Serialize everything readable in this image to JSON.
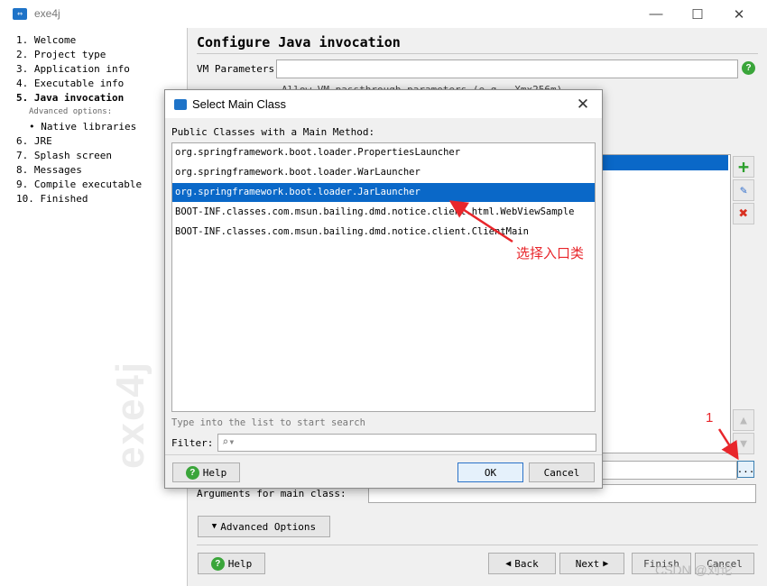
{
  "window": {
    "title": "exe4j",
    "minimize": "—",
    "maximize": "☐",
    "close": "✕"
  },
  "sidebar": {
    "steps": [
      {
        "label": "1.  Welcome"
      },
      {
        "label": "2.  Project type"
      },
      {
        "label": "3.  Application info"
      },
      {
        "label": "4.  Executable info"
      },
      {
        "label": "5.  Java invocation"
      },
      {
        "label": "Advanced options:"
      },
      {
        "label": "• Native libraries"
      },
      {
        "label": "6.  JRE"
      },
      {
        "label": "7.  Splash screen"
      },
      {
        "label": "8.  Messages"
      },
      {
        "label": "9.  Compile executable"
      },
      {
        "label": "10.  Finished"
      }
    ],
    "watermark": "exe4j"
  },
  "page": {
    "title": "Configure Java invocation",
    "vm_parameters_label": "VM Parameters:",
    "vm_parameters_value": "",
    "checkbox_partial": "Allow VM passthrough parameters (e.g. -Xmx256m)",
    "arguments_label": "Arguments for main class:",
    "arguments_value": "",
    "main_class_value": "",
    "advanced_options_label": "Advanced Options",
    "browse_label": "...",
    "help_label": "Help",
    "back_label": "Back",
    "next_label": "Next",
    "finish_label": "Finish",
    "cancel_label": "Cancel"
  },
  "dialog": {
    "title": "Select Main Class",
    "list_label": "Public Classes with a Main Method:",
    "classes": [
      {
        "name": "org.springframework.boot.loader.PropertiesLauncher"
      },
      {
        "name": "org.springframework.boot.loader.WarLauncher"
      },
      {
        "name": "org.springframework.boot.loader.JarLauncher",
        "selected": true
      },
      {
        "name": "BOOT-INF.classes.com.msun.bailing.dmd.notice.client.html.WebViewSample"
      },
      {
        "name": "BOOT-INF.classes.com.msun.bailing.dmd.notice.client.ClientMain"
      }
    ],
    "search_hint": "Type into the list to start search",
    "filter_label": "Filter:",
    "filter_value": "",
    "help_label": "Help",
    "ok_label": "OK",
    "cancel_label": "Cancel",
    "close_label": "✕"
  },
  "annotations": {
    "select_entry_class": "选择入口类",
    "step_number": "1",
    "color": "#e8262b"
  },
  "watermark_text": "CSDN @刘论",
  "colors": {
    "selection": "#0a68c8",
    "help_green": "#3aa53a",
    "delete_red": "#d83020",
    "brand_blue": "#1e73c8"
  }
}
